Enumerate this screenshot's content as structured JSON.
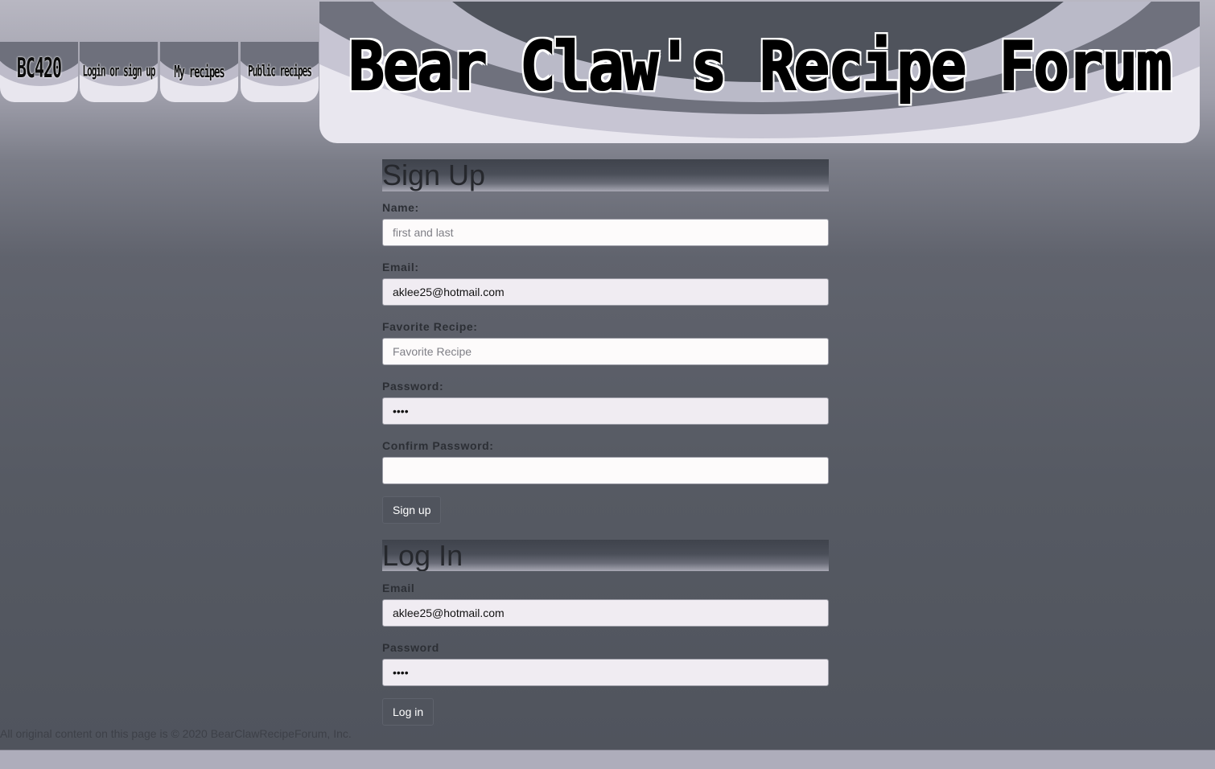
{
  "nav": {
    "items": [
      {
        "label": "BC420"
      },
      {
        "label": "Login or sign up"
      },
      {
        "label": "My recipes"
      },
      {
        "label": "Public recipes"
      }
    ]
  },
  "banner": {
    "title": "Bear Claw's Recipe Forum"
  },
  "signup": {
    "heading": "Sign Up",
    "name_label": "Name:",
    "name_placeholder": "first and last",
    "name_value": "",
    "email_label": "Email:",
    "email_value": "aklee25@hotmail.com",
    "favorite_label": "Favorite Recipe:",
    "favorite_placeholder": "Favorite Recipe",
    "favorite_value": "",
    "password_label": "Password:",
    "password_value": "••••",
    "confirm_label": "Confirm Password:",
    "confirm_value": "",
    "button_label": "Sign up"
  },
  "login": {
    "heading": "Log In",
    "email_label": "Email",
    "email_value": "aklee25@hotmail.com",
    "password_label": "Password",
    "password_value": "••••",
    "button_label": "Log in"
  },
  "footer": {
    "text": "All original content on this page is © 2020 BearClawRecipeForum, Inc."
  }
}
